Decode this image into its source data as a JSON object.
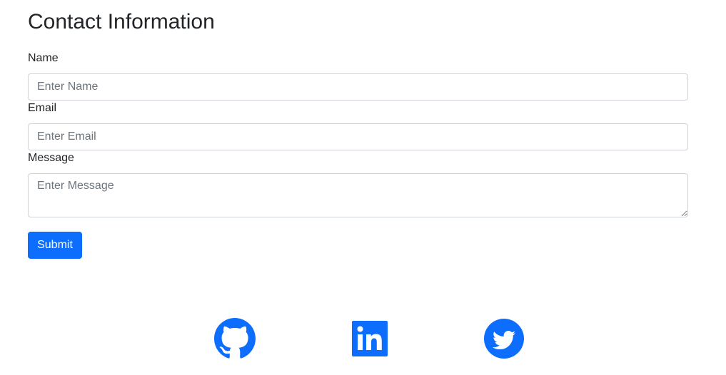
{
  "page": {
    "title": "Contact Information"
  },
  "form": {
    "name": {
      "label": "Name",
      "placeholder": "Enter Name",
      "value": ""
    },
    "email": {
      "label": "Email",
      "placeholder": "Enter Email",
      "value": ""
    },
    "message": {
      "label": "Message",
      "placeholder": "Enter Message",
      "value": ""
    },
    "submit_label": "Submit"
  },
  "social": {
    "icons": [
      "github-icon",
      "linkedin-icon",
      "twitter-icon"
    ],
    "color": "#0d6efd"
  },
  "colors": {
    "accent": "#0d6efd",
    "text": "#212529",
    "placeholder": "#6c757d",
    "border": "#ced4da"
  }
}
